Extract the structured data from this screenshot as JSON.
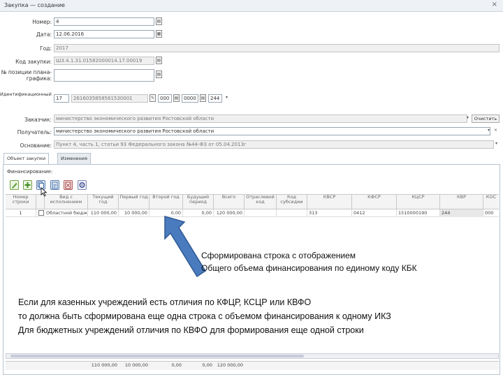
{
  "window": {
    "title": "Закупка — создание",
    "close_glyph": "×"
  },
  "form": {
    "number": {
      "label": "Номер:",
      "value": "4"
    },
    "date": {
      "label": "Дата:",
      "value": "12.06.2016"
    },
    "year": {
      "label": "Год:",
      "value": "2017"
    },
    "purchase_code": {
      "label": "Код закупки:",
      "value": "Ш3.4.1.31.01582000014.17.00019"
    },
    "schedule_position": {
      "label_line1": "№ позиции плана-",
      "label_line2": "графика:",
      "value": ""
    },
    "ikz": {
      "label": "Идентификационный код закупки:",
      "part1": "17",
      "part2": "2616035858561530001",
      "part3": "000",
      "part4": "0000",
      "part5": "244"
    },
    "customer": {
      "label": "Заказчик:",
      "value": "министерство экономического развития Ростовской области",
      "button": "Очистить"
    },
    "recipient": {
      "label": "Получатель:",
      "value": "министерство экономического развития Ростовской области"
    },
    "basis": {
      "label": "Основание:",
      "value": "Пункт 4, часть 1, статьи 93 Федерального закона №44-ФЗ от 05.04.2013г"
    }
  },
  "tabs": [
    {
      "label": "Объект закупки"
    },
    {
      "label": "Изменения"
    }
  ],
  "financing": {
    "section_label": "Финансирование:",
    "columns": [
      "Номер строки",
      "",
      "Вид с исполнением",
      "Текущий год",
      "Первый год",
      "Второй год",
      "Будущий период",
      "Всего",
      "Отраслевой код",
      "Код субсидии",
      "КВСР",
      "КФСР",
      "КЦСР",
      "КВР",
      "КОС"
    ],
    "rows": [
      {
        "num": "1",
        "type": "Областной бюджет",
        "current_year": "110 000,00",
        "first_year": "10 000,00",
        "second_year": "0,00",
        "future": "0,00",
        "total": "120 000,00",
        "industry_code": "",
        "subsidy_code": "",
        "kvsr": "313",
        "kfsr": "0412",
        "kcsr": "1510000190",
        "kvr": "244",
        "kosgu": "000"
      }
    ],
    "totals": {
      "current_year": "110 000,00",
      "first_year": "10 000,00",
      "second_year": "0,00",
      "future": "0,00",
      "total": "120 000,00"
    }
  },
  "annotations": {
    "note1_line1": "Сформирована строка с отображением",
    "note1_line2": "Общего объема финансирования по единому коду КБК",
    "note2_line1": "Если для казенных учреждений есть отличия по КФЦР, КСЦР или КВФО",
    "note2_line2": "то должна быть сформирована еще одна строка с объемом финансирования к одному ИКЗ",
    "note2_line3": "Для бюджетных учреждений отличия по КВФО для формирования  еще одной строки"
  },
  "colors": {
    "arrow": "#4a7bbf",
    "arrow_stroke": "#2f5a94",
    "accent": "#b8c2cc"
  },
  "icons": [
    "edit-icon",
    "add-icon",
    "copy-icon",
    "paste-icon",
    "excel-icon",
    "settings-icon",
    "calendar-icon",
    "lookup-icon",
    "clear-icon",
    "arrow-up-icon"
  ]
}
